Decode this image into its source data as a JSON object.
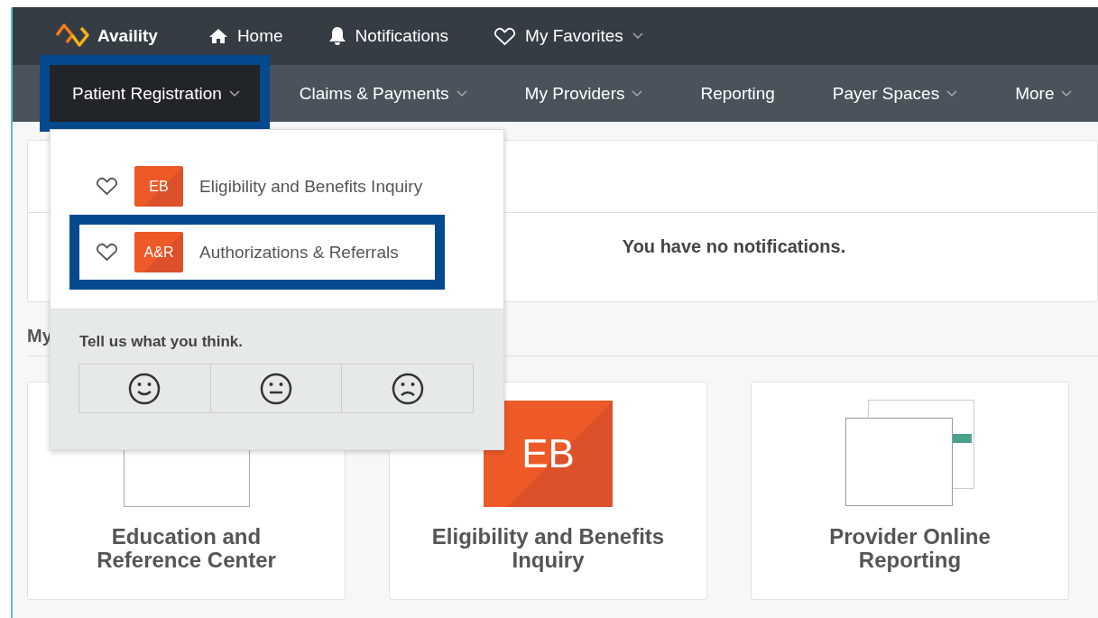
{
  "header": {
    "logo": "Availity",
    "links": [
      {
        "kind": "home",
        "label": "Home",
        "dropdown": false
      },
      {
        "kind": "bell",
        "label": "Notifications",
        "dropdown": false
      },
      {
        "kind": "heart",
        "label": "My Favorites",
        "dropdown": true
      }
    ]
  },
  "nav": [
    {
      "label": "Patient Registration",
      "dropdown": true,
      "selected": true,
      "highlighted": true
    },
    {
      "label": "Claims & Payments",
      "dropdown": true,
      "selected": false,
      "highlighted": false
    },
    {
      "label": "My Providers",
      "dropdown": true,
      "selected": false,
      "highlighted": false
    },
    {
      "label": "Reporting",
      "dropdown": false,
      "selected": false,
      "highlighted": false
    },
    {
      "label": "Payer Spaces",
      "dropdown": true,
      "selected": false,
      "highlighted": false
    },
    {
      "label": "More",
      "dropdown": true,
      "selected": false,
      "highlighted": false
    }
  ],
  "menu": {
    "items": [
      {
        "badge": "EB",
        "label": "Eligibility and Benefits Inquiry",
        "highlighted": false
      },
      {
        "badge": "A&R",
        "label": "Authorizations & Referrals",
        "highlighted": true
      }
    ],
    "feedback": {
      "prompt": "Tell us what you think.",
      "options": [
        {
          "kind": "happy"
        },
        {
          "kind": "neutral"
        },
        {
          "kind": "sad"
        }
      ]
    }
  },
  "notifications": {
    "message": "You have no notifications."
  },
  "section": {
    "title": "My"
  },
  "cards": [
    {
      "kind": "blank",
      "title": "Education and Reference Center"
    },
    {
      "kind": "tile",
      "tile": "EB",
      "title": "Eligibility and Benefits Inquiry"
    },
    {
      "kind": "stack",
      "title": "Provider Online Reporting"
    }
  ]
}
